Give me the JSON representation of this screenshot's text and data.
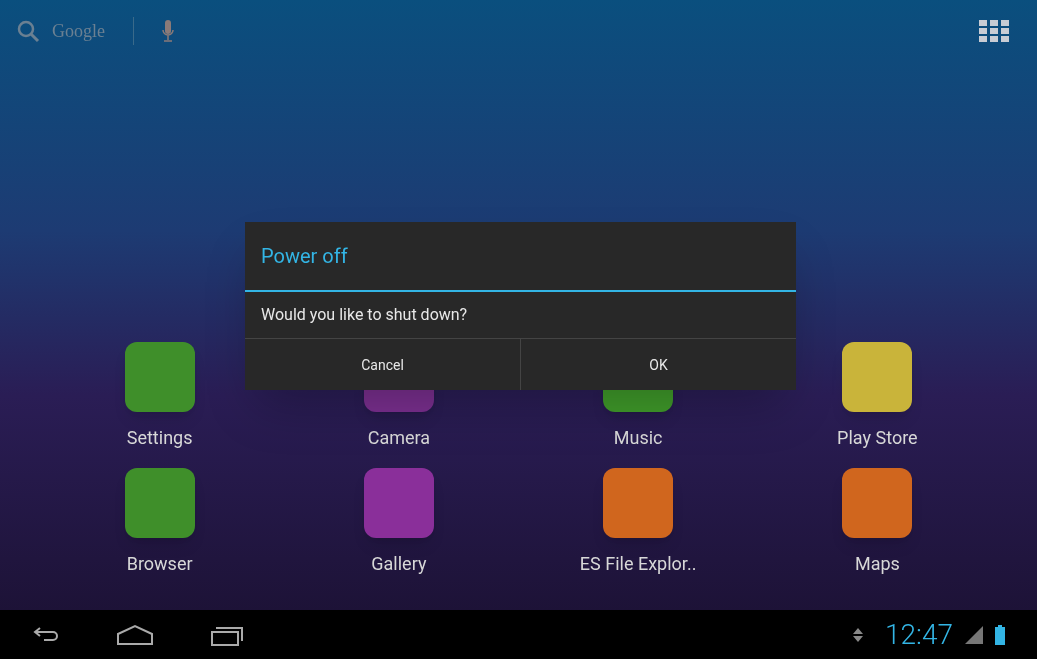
{
  "search": {
    "label": "Google"
  },
  "apps": [
    {
      "label": "Settings",
      "color": "#3f8f2a"
    },
    {
      "label": "Camera",
      "color": "#7a2f8f"
    },
    {
      "label": "Music",
      "color": "#3f9a2a"
    },
    {
      "label": "Play Store",
      "color": "#c9b43a"
    },
    {
      "label": "Browser",
      "color": "#3f8f2a"
    },
    {
      "label": "Gallery",
      "color": "#8a2f9a"
    },
    {
      "label": "ES File Explor..",
      "color": "#d0661e"
    },
    {
      "label": "Maps",
      "color": "#d0661e"
    }
  ],
  "dialog": {
    "title": "Power off",
    "message": "Would you like to shut down?",
    "buttons": [
      "Cancel",
      "OK"
    ]
  },
  "status_bar": {
    "time": "12:47"
  }
}
